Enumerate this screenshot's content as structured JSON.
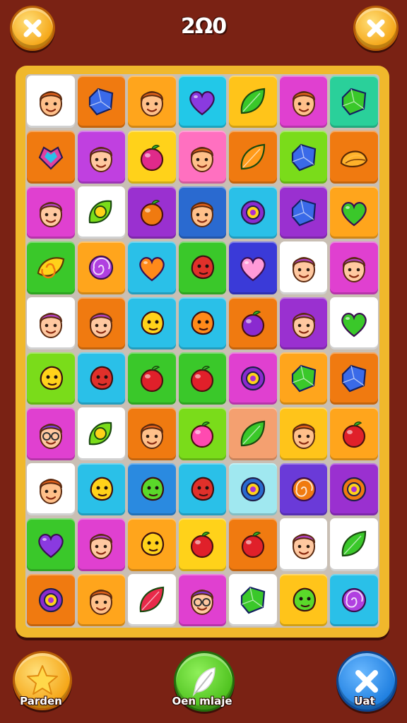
{
  "header": {
    "score_text": "2Ω0",
    "left_button_icon": "close-icon",
    "right_button_icon": "close-icon"
  },
  "colors": {
    "background": "#7a2214",
    "board_frame": "#f0b82c",
    "accent_yellow": "#f5a516",
    "accent_green": "#4fc21f",
    "accent_blue": "#1f7fe0"
  },
  "board": {
    "rows": 10,
    "cols": 7,
    "tiles": [
      [
        "face-man-icon",
        "blue-gem-icon",
        "face-man-icon",
        "purple-heart-icon",
        "green-leaf-icon",
        "face-man-icon",
        "green-gem-icon"
      ],
      [
        "heart-gem-icon",
        "face-woman-icon",
        "magenta-fruit-icon",
        "face-man-icon",
        "orange-leaf-icon",
        "blue-gem-icon",
        "orange-shell-icon"
      ],
      [
        "face-woman-icon",
        "green-ring-icon",
        "orange-fruit-icon",
        "face-man-icon",
        "purple-ring-icon",
        "blue-gem-icon",
        "green-heart-icon"
      ],
      [
        "swirl-leaf-icon",
        "purple-swirl-icon",
        "orange-heart-icon",
        "red-creature-icon",
        "pink-heart-icon",
        "face-woman-icon",
        "face-woman-icon"
      ],
      [
        "face-woman-icon",
        "face-woman-icon",
        "yellow-creature-icon",
        "orange-creature-icon",
        "purple-fruit-icon",
        "face-woman-icon",
        "green-heart-icon"
      ],
      [
        "yellow-creature-icon",
        "red-creature-icon",
        "red-fruit-icon",
        "red-fruit-icon",
        "purple-ring-icon",
        "green-gem-icon",
        "blue-gem-icon"
      ],
      [
        "face-glasses-icon",
        "green-ring-icon",
        "face-man-icon",
        "pink-fruit-icon",
        "green-leaf-icon",
        "face-man-icon",
        "red-fruit-icon"
      ],
      [
        "face-man-icon",
        "yellow-creature-icon",
        "green-creature-icon",
        "red-creature-icon",
        "blue-ring-icon",
        "orange-swirl-icon",
        "orange-ring-icon"
      ],
      [
        "purple-heart-icon",
        "face-woman-icon",
        "yellow-creature-icon",
        "red-fruit-icon",
        "red-fruit-icon",
        "face-woman-icon",
        "green-leaf-icon"
      ],
      [
        "purple-ring-icon",
        "face-man-icon",
        "red-leaf-icon",
        "face-glasses-icon",
        "green-gem-icon",
        "green-creature-icon",
        "purple-swirl-icon"
      ]
    ],
    "tile_colors": [
      [
        "#ffffff",
        "#f07a10",
        "#ffa51c",
        "#22c8e8",
        "#ffc41a",
        "#e040d0",
        "#2ad09a"
      ],
      [
        "#f07a10",
        "#c040e0",
        "#ffd21a",
        "#ff70c0",
        "#f07a10",
        "#7adc1a",
        "#f07a10"
      ],
      [
        "#e040d0",
        "#ffffff",
        "#9a30d0",
        "#2a6ad0",
        "#2ac0e8",
        "#9a30d0",
        "#ffa51c"
      ],
      [
        "#3ac82a",
        "#ffa51c",
        "#2ac0e8",
        "#3ac82a",
        "#3a3ad8",
        "#ffffff",
        "#e040d0"
      ],
      [
        "#ffffff",
        "#f07a10",
        "#2ac0e8",
        "#2ac0e8",
        "#f07a10",
        "#9a30d0",
        "#ffffff"
      ],
      [
        "#7adc1a",
        "#2ac0e8",
        "#3ac82a",
        "#3ac82a",
        "#e040d0",
        "#ffa51c",
        "#f07a10"
      ],
      [
        "#e040d0",
        "#ffffff",
        "#f07a10",
        "#7adc1a",
        "#f4a070",
        "#ffc41a",
        "#ffa51c"
      ],
      [
        "#ffffff",
        "#2ac0e8",
        "#2a8ae0",
        "#2ac0e8",
        "#a0e8f0",
        "#6a3ad8",
        "#9a30d0"
      ],
      [
        "#3ac82a",
        "#e040d0",
        "#ffa51c",
        "#ffd21a",
        "#f07a10",
        "#ffffff",
        "#ffffff"
      ],
      [
        "#f07a10",
        "#ffa51c",
        "#ffffff",
        "#e040d0",
        "#ffffff",
        "#ffc41a",
        "#2ac0e8"
      ]
    ]
  },
  "footer": {
    "left_label": "Parden",
    "center_label": "Oen mlaje",
    "right_label": "Uat",
    "left_icon": "star-icon",
    "center_icon": "feather-icon",
    "right_icon": "close-icon"
  }
}
